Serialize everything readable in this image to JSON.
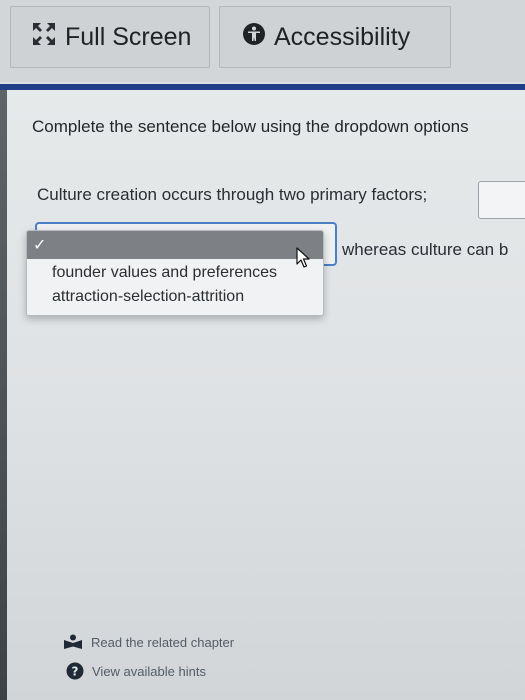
{
  "toolbar": {
    "full_screen_label": "Full Screen",
    "accessibility_label": "Accessibility"
  },
  "question": {
    "instruction": "Complete the sentence below using the dropdown options",
    "sentence_part1": "Culture creation occurs through two primary factors;",
    "sentence_part2": "whereas culture can b"
  },
  "dropdown": {
    "selected_checkmark": "✓",
    "options": [
      "founder values and preferences",
      "attraction-selection-attrition"
    ]
  },
  "footer": {
    "chapter_link": "Read the related chapter",
    "hints_link": "View available hints",
    "hints_icon_glyph": "?"
  },
  "colors": {
    "accent_bar": "#1e3f86",
    "select_border": "#4b7fc5",
    "selected_option_bg": "#7d8186"
  }
}
